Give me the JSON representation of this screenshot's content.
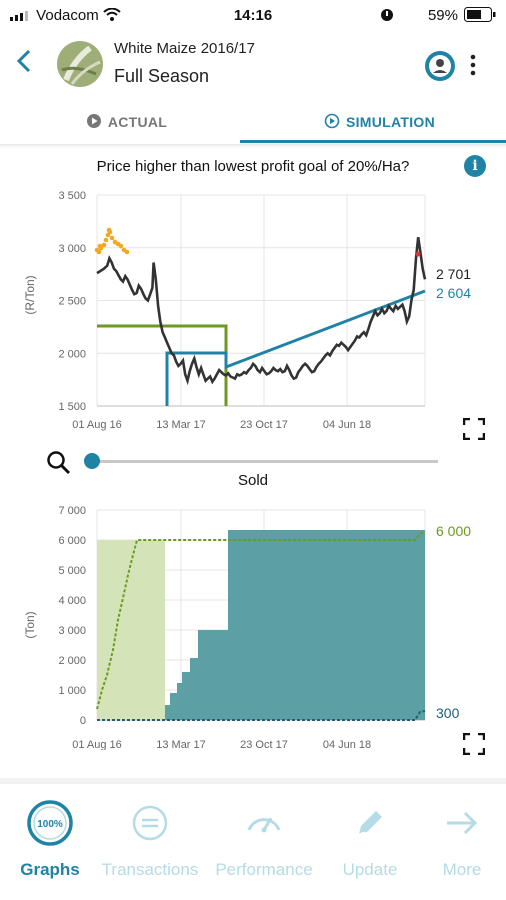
{
  "status_bar": {
    "carrier": "Vodacom",
    "time": "14:16",
    "battery": "59%"
  },
  "header": {
    "title": "White Maize 2016/17",
    "subtitle": "Full Season"
  },
  "tabs": [
    {
      "label": "ACTUAL",
      "active": false
    },
    {
      "label": "SIMULATION",
      "active": true
    }
  ],
  "price_chart": {
    "title": "Price higher than lowest profit goal of 20%/Ha?",
    "end_label_black": "2 701",
    "end_label_blue": "2 604"
  },
  "sold_chart": {
    "title": "Sold",
    "end_label_green": "6 000",
    "end_label_teal": "300"
  },
  "chart_data": [
    {
      "type": "line",
      "title": "Price higher than lowest profit goal of 20%/Ha?",
      "ylabel": "(R/Ton)",
      "ylim": [
        1500,
        3500
      ],
      "yticks": [
        "1 500",
        "2 000",
        "2 500",
        "3 000",
        "3 500"
      ],
      "xticks": [
        "01 Aug 16",
        "13 Mar 17",
        "23 Oct 17",
        "04 Jun 18"
      ],
      "grid": true,
      "series": [
        {
          "color": "#333333",
          "points": [
            [
              0,
              2760
            ],
            [
              3,
              2780
            ],
            [
              6,
              2800
            ],
            [
              9,
              2830
            ],
            [
              11,
              2900
            ],
            [
              13,
              2860
            ],
            [
              15,
              2800
            ],
            [
              17,
              2780
            ],
            [
              19,
              2740
            ],
            [
              21,
              2700
            ],
            [
              23,
              2680
            ],
            [
              25,
              2730
            ],
            [
              27,
              2700
            ],
            [
              29,
              2650
            ],
            [
              31,
              2600
            ],
            [
              33,
              2560
            ],
            [
              35,
              2570
            ],
            [
              37,
              2640
            ],
            [
              39,
              2610
            ],
            [
              41,
              2560
            ],
            [
              43,
              2520
            ],
            [
              45,
              2500
            ],
            [
              47,
              2560
            ],
            [
              49,
              2620
            ],
            [
              50,
              2860
            ],
            [
              52,
              2700
            ],
            [
              54,
              2450
            ],
            [
              56,
              2300
            ],
            [
              58,
              2200
            ],
            [
              60,
              2150
            ],
            [
              62,
              2100
            ],
            [
              64,
              2050
            ],
            [
              66,
              2000
            ],
            [
              68,
              1980
            ],
            [
              70,
              1920
            ],
            [
              72,
              1880
            ],
            [
              74,
              1900
            ],
            [
              76,
              1930
            ],
            [
              78,
              1800
            ],
            [
              80,
              1740
            ],
            [
              82,
              1830
            ],
            [
              84,
              1900
            ],
            [
              86,
              1950
            ],
            [
              88,
              1870
            ],
            [
              90,
              1800
            ],
            [
              92,
              1860
            ],
            [
              94,
              1800
            ],
            [
              96,
              1740
            ],
            [
              98,
              1760
            ],
            [
              100,
              1780
            ],
            [
              102,
              1730
            ],
            [
              104,
              1760
            ],
            [
              106,
              1800
            ],
            [
              108,
              1840
            ],
            [
              110,
              1820
            ],
            [
              112,
              1800
            ],
            [
              114,
              1790
            ],
            [
              116,
              1810
            ],
            [
              118,
              1780
            ],
            [
              120,
              1770
            ],
            [
              122,
              1760
            ],
            [
              124,
              1800
            ],
            [
              126,
              1790
            ],
            [
              128,
              1800
            ],
            [
              130,
              1820
            ],
            [
              132,
              1810
            ],
            [
              134,
              1840
            ],
            [
              136,
              1860
            ],
            [
              138,
              1900
            ],
            [
              140,
              1880
            ],
            [
              142,
              1840
            ],
            [
              144,
              1820
            ],
            [
              146,
              1860
            ],
            [
              148,
              1830
            ],
            [
              150,
              1800
            ],
            [
              152,
              1810
            ],
            [
              154,
              1830
            ],
            [
              156,
              1860
            ],
            [
              158,
              1840
            ],
            [
              160,
              1830
            ],
            [
              162,
              1850
            ],
            [
              164,
              1820
            ],
            [
              166,
              1830
            ],
            [
              168,
              1880
            ],
            [
              170,
              1840
            ],
            [
              172,
              1790
            ],
            [
              174,
              1760
            ],
            [
              176,
              1770
            ],
            [
              178,
              1820
            ],
            [
              180,
              1850
            ],
            [
              182,
              1880
            ],
            [
              184,
              1900
            ],
            [
              186,
              1880
            ],
            [
              188,
              1850
            ],
            [
              190,
              1820
            ],
            [
              192,
              1830
            ],
            [
              194,
              1870
            ],
            [
              196,
              1900
            ],
            [
              198,
              1920
            ],
            [
              200,
              1950
            ],
            [
              202,
              1980
            ],
            [
              204,
              2000
            ],
            [
              206,
              1980
            ],
            [
              208,
              2020
            ],
            [
              210,
              2050
            ],
            [
              212,
              2080
            ],
            [
              214,
              2070
            ],
            [
              216,
              2100
            ],
            [
              218,
              2080
            ],
            [
              220,
              2060
            ],
            [
              222,
              2030
            ],
            [
              224,
              2060
            ],
            [
              226,
              2090
            ],
            [
              228,
              2120
            ],
            [
              230,
              2160
            ],
            [
              232,
              2150
            ],
            [
              234,
              2180
            ],
            [
              236,
              2200
            ],
            [
              238,
              2170
            ],
            [
              240,
              2230
            ],
            [
              242,
              2300
            ],
            [
              244,
              2350
            ],
            [
              246,
              2400
            ],
            [
              248,
              2360
            ],
            [
              250,
              2380
            ],
            [
              252,
              2420
            ],
            [
              254,
              2380
            ],
            [
              256,
              2400
            ],
            [
              258,
              2450
            ],
            [
              260,
              2420
            ],
            [
              262,
              2400
            ],
            [
              264,
              2450
            ],
            [
              266,
              2420
            ],
            [
              268,
              2440
            ],
            [
              270,
              2460
            ],
            [
              272,
              2400
            ],
            [
              274,
              2300
            ],
            [
              276,
              2350
            ],
            [
              278,
              2500
            ],
            [
              280,
              2600
            ],
            [
              282,
              2900
            ],
            [
              284,
              3100
            ],
            [
              286,
              2950
            ],
            [
              288,
              2800
            ],
            [
              290,
              2701
            ]
          ]
        },
        {
          "color": "#1f83a6",
          "points": [
            [
              0,
              1500
            ],
            [
              0,
              2000
            ],
            [
              0,
              2000
            ],
            [
              0,
              1750
            ]
          ]
        }
      ]
    },
    {
      "type": "area",
      "title": "Sold",
      "ylabel": "(Ton)",
      "ylim": [
        0,
        7000
      ],
      "yticks": [
        "0",
        "1 000",
        "2 000",
        "3 000",
        "4 000",
        "5 000",
        "6 000",
        "7 000"
      ],
      "xticks": [
        "01 Aug 16",
        "13 Mar 17",
        "23 Oct 17",
        "04 Jun 18"
      ],
      "grid": true,
      "series": [
        {
          "name": "",
          "color": "#8ab43c",
          "end_value": 6000
        },
        {
          "name": "",
          "color": "#1f83a6",
          "end_value": 300
        }
      ]
    }
  ],
  "nav": [
    {
      "label": "Graphs",
      "icon": "graphs-100-icon",
      "badge": "100%",
      "active": true
    },
    {
      "label": "Transactions",
      "icon": "list-circle-icon",
      "active": false
    },
    {
      "label": "Performance",
      "icon": "gauge-icon",
      "active": false
    },
    {
      "label": "Update",
      "icon": "pencil-icon",
      "active": false
    },
    {
      "label": "More",
      "icon": "arrow-right-icon",
      "active": false
    }
  ]
}
